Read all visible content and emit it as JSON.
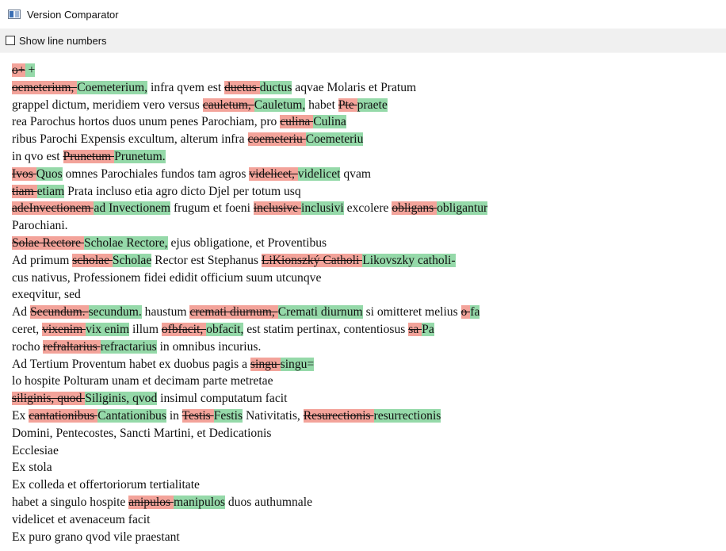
{
  "window": {
    "title": "Version Comparator"
  },
  "toolbar": {
    "show_line_numbers_label": "Show line numbers",
    "show_line_numbers_checked": false
  },
  "colors": {
    "deleted": "#f3a39a",
    "inserted": "#95d9a9"
  },
  "diff_lines": [
    [
      {
        "t": "del",
        "v": "o+"
      },
      {
        "t": "ins",
        "v": " +"
      }
    ],
    [
      {
        "t": "del",
        "v": "oemeterium, "
      },
      {
        "t": "ins",
        "v": "Coemeterium,"
      },
      {
        "t": "eq",
        "v": " infra qvem est "
      },
      {
        "t": "del",
        "v": "duetus "
      },
      {
        "t": "ins",
        "v": "ductus"
      },
      {
        "t": "eq",
        "v": " aqvae Molaris et Pratum"
      }
    ],
    [
      {
        "t": "eq",
        "v": "grappel dictum, meridiem vero versus "
      },
      {
        "t": "del",
        "v": "cauletum, "
      },
      {
        "t": "ins",
        "v": "Cauletum,"
      },
      {
        "t": "eq",
        "v": " habet "
      },
      {
        "t": "del",
        "v": "Pte "
      },
      {
        "t": "ins",
        "v": " praete"
      }
    ],
    [
      {
        "t": "eq",
        "v": "rea Parochus hortos duos unum penes Parochiam, pro "
      },
      {
        "t": "del",
        "v": "culina "
      },
      {
        "t": "ins",
        "v": "Culina"
      }
    ],
    [
      {
        "t": "eq",
        "v": "ribus Parochi Expensis excultum, alterum infra "
      },
      {
        "t": "del",
        "v": "coemeteriu "
      },
      {
        "t": "ins",
        "v": "Coemeteriu"
      }
    ],
    [
      {
        "t": "eq",
        "v": "in qvo est "
      },
      {
        "t": "del",
        "v": "Prunetum "
      },
      {
        "t": "ins",
        "v": "Prunetum."
      }
    ],
    [
      {
        "t": "del",
        "v": "Ivos "
      },
      {
        "t": "ins",
        "v": "Quos"
      },
      {
        "t": "eq",
        "v": " omnes Parochiales fundos tam agros "
      },
      {
        "t": "del",
        "v": "videlicet, "
      },
      {
        "t": "ins",
        "v": "videlicet"
      },
      {
        "t": "eq",
        "v": " qvam"
      }
    ],
    [
      {
        "t": "del",
        "v": "tiam "
      },
      {
        "t": "ins",
        "v": "etiam"
      },
      {
        "t": "eq",
        "v": " Prata incluso etia agro dicto Djel per totum usq"
      }
    ],
    [
      {
        "t": "del",
        "v": "adeInvectionem "
      },
      {
        "t": "ins",
        "v": "ad Invectionem"
      },
      {
        "t": "eq",
        "v": " frugum et foeni "
      },
      {
        "t": "del",
        "v": "inclusive "
      },
      {
        "t": "ins",
        "v": "inclusivi"
      },
      {
        "t": "eq",
        "v": " excolere "
      },
      {
        "t": "del",
        "v": "obligans "
      },
      {
        "t": "ins",
        "v": "obligantur"
      }
    ],
    [
      {
        "t": "eq",
        "v": "Parochiani."
      }
    ],
    [
      {
        "t": "del",
        "v": "Solae Rectore "
      },
      {
        "t": "ins",
        "v": "Scholae Rectore,"
      },
      {
        "t": "eq",
        "v": " ejus obligatione, et Proventibus"
      }
    ],
    [
      {
        "t": "eq",
        "v": "Ad primum "
      },
      {
        "t": "del",
        "v": "scholae "
      },
      {
        "t": "ins",
        "v": "Scholae"
      },
      {
        "t": "eq",
        "v": " Rector est Stephanus "
      },
      {
        "t": "del",
        "v": "LiKionszký Catholi "
      },
      {
        "t": "ins",
        "v": "Likovszky catholi-"
      }
    ],
    [
      {
        "t": "eq",
        "v": "cus nativus, Professionem fidei edidit officium suum utcunqve"
      }
    ],
    [
      {
        "t": "eq",
        "v": "exeqvitur, sed"
      }
    ],
    [
      {
        "t": "eq",
        "v": "Ad "
      },
      {
        "t": "del",
        "v": "Secundum. "
      },
      {
        "t": "ins",
        "v": "secundum."
      },
      {
        "t": "eq",
        "v": " haustum "
      },
      {
        "t": "del",
        "v": "cremati diurnum, "
      },
      {
        "t": "ins",
        "v": "Cremati diurnum"
      },
      {
        "t": "eq",
        "v": " si omitteret melius "
      },
      {
        "t": "del",
        "v": "o "
      },
      {
        "t": "ins",
        "v": "fa"
      }
    ],
    [
      {
        "t": "eq",
        "v": "ceret, "
      },
      {
        "t": "del",
        "v": "vixenim "
      },
      {
        "t": "ins",
        "v": "vix enim"
      },
      {
        "t": "eq",
        "v": " illum "
      },
      {
        "t": "del",
        "v": "ofbfacit, "
      },
      {
        "t": "ins",
        "v": "obfacit,"
      },
      {
        "t": "eq",
        "v": " est statim pertinax, contentiosus "
      },
      {
        "t": "del",
        "v": "sa "
      },
      {
        "t": "ins",
        "v": " Pa"
      }
    ],
    [
      {
        "t": "eq",
        "v": "rocho "
      },
      {
        "t": "del",
        "v": "refraltarius "
      },
      {
        "t": "ins",
        "v": "refractarius"
      },
      {
        "t": "eq",
        "v": " in omnibus incurius."
      }
    ],
    [
      {
        "t": "eq",
        "v": "Ad Tertium Proventum habet ex duobus pagis a "
      },
      {
        "t": "del",
        "v": "singu "
      },
      {
        "t": "ins",
        "v": "singu="
      }
    ],
    [
      {
        "t": "eq",
        "v": "lo hospite Polturam unam et decimam parte metretae"
      }
    ],
    [
      {
        "t": "del",
        "v": "siliginis, quod "
      },
      {
        "t": "ins",
        "v": "Siliginis, qvod"
      },
      {
        "t": "eq",
        "v": " insimul computatum facit"
      }
    ],
    [
      {
        "t": "eq",
        "v": "Ex "
      },
      {
        "t": "del",
        "v": "cantationibus "
      },
      {
        "t": "ins",
        "v": "Cantationibus"
      },
      {
        "t": "eq",
        "v": " in "
      },
      {
        "t": "del",
        "v": "Testis "
      },
      {
        "t": "ins",
        "v": "Festis"
      },
      {
        "t": "eq",
        "v": " Nativitatis, "
      },
      {
        "t": "del",
        "v": "Resurectionis "
      },
      {
        "t": "ins",
        "v": "resurrectionis"
      }
    ],
    [
      {
        "t": "eq",
        "v": "Domini, Pentecostes, Sancti Martini, et Dedicationis"
      }
    ],
    [
      {
        "t": "eq",
        "v": "Ecclesiae"
      }
    ],
    [
      {
        "t": "eq",
        "v": "Ex stola"
      }
    ],
    [
      {
        "t": "eq",
        "v": "Ex colleda et offertoriorum tertialitate"
      }
    ],
    [
      {
        "t": "eq",
        "v": "habet a singulo hospite "
      },
      {
        "t": "del",
        "v": "anipulos "
      },
      {
        "t": "ins",
        "v": "manipulos"
      },
      {
        "t": "eq",
        "v": " duos authumnale"
      }
    ],
    [
      {
        "t": "eq",
        "v": "videlicet et avenaceum facit"
      }
    ],
    [
      {
        "t": "eq",
        "v": "Ex puro grano qvod vile praestant"
      }
    ]
  ]
}
